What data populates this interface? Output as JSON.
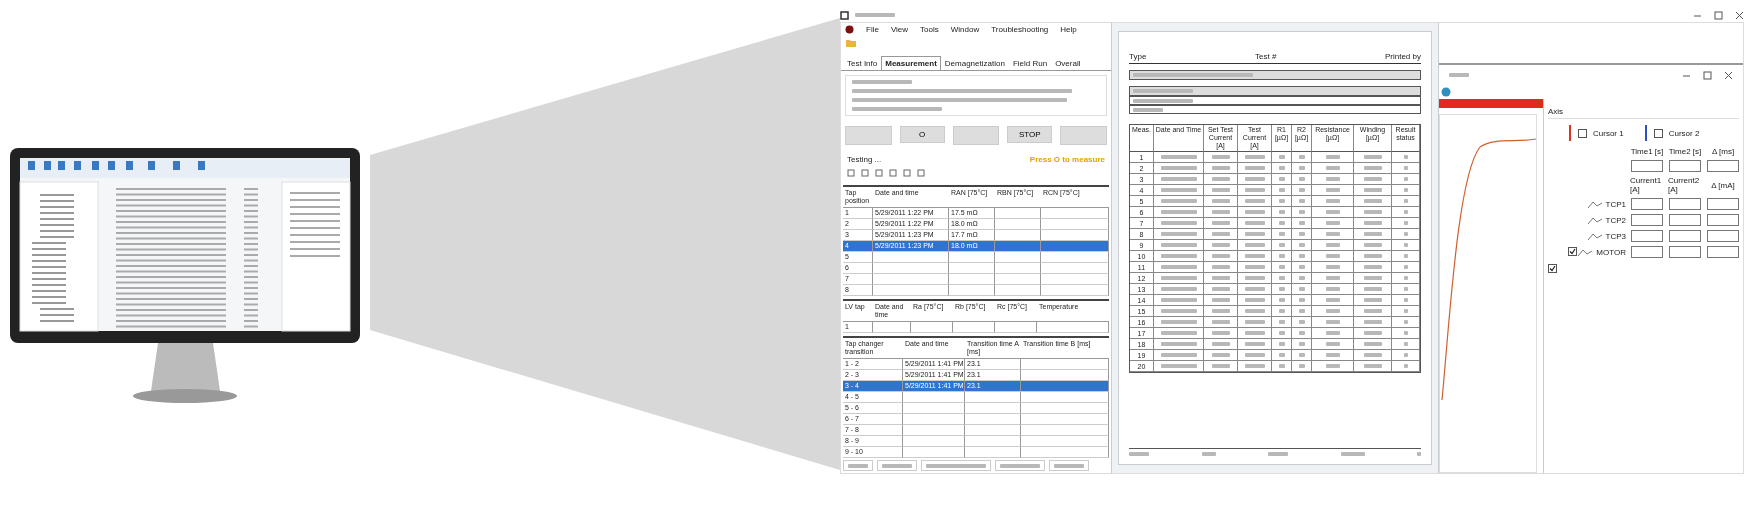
{
  "app_window": {
    "menu": [
      "File",
      "View",
      "Tools",
      "Window",
      "Troubleshooting",
      "Help"
    ],
    "tabs": [
      {
        "label": "Test Info",
        "selected": false
      },
      {
        "label": "Measurement",
        "selected": true
      },
      {
        "label": "Demagnetization",
        "selected": false
      },
      {
        "label": "Field Run",
        "selected": false
      },
      {
        "label": "Overall",
        "selected": false
      }
    ],
    "buttons": [
      "O",
      "STOP"
    ],
    "status": "Testing ...",
    "hint": "Press O to measure",
    "tap_table": {
      "columns": [
        "Tap position",
        "Date and time",
        "RAN [75°C]",
        "RBN [75°C]",
        "RCN [75°C]"
      ],
      "rows": [
        {
          "cells": [
            "1",
            "5/29/2011 1:22 PM",
            "17.5 mΩ",
            "",
            ""
          ],
          "selected": false
        },
        {
          "cells": [
            "2",
            "5/29/2011 1:22 PM",
            "18.0 mΩ",
            "",
            ""
          ],
          "selected": false
        },
        {
          "cells": [
            "3",
            "5/29/2011 1:23 PM",
            "17.7 mΩ",
            "",
            ""
          ],
          "selected": false
        },
        {
          "cells": [
            "4",
            "5/29/2011 1:23 PM",
            "18.0 mΩ",
            "",
            ""
          ],
          "selected": true
        },
        {
          "cells": [
            "5",
            "",
            "",
            "",
            ""
          ],
          "selected": false
        },
        {
          "cells": [
            "6",
            "",
            "",
            "",
            ""
          ],
          "selected": false
        },
        {
          "cells": [
            "7",
            "",
            "",
            "",
            ""
          ],
          "selected": false
        },
        {
          "cells": [
            "8",
            "",
            "",
            "",
            ""
          ],
          "selected": false
        }
      ]
    },
    "lv_table": {
      "columns": [
        "LV tap",
        "Date and time",
        "Ra [75°C]",
        "Rb [75°C]",
        "Rc [75°C]",
        "Temperature"
      ],
      "rows": [
        {
          "cells": [
            "1",
            "",
            "",
            "",
            "",
            ""
          ],
          "selected": false
        }
      ]
    },
    "transition_table": {
      "columns": [
        "Tap changer transition",
        "Date and time",
        "Transition time A [ms]",
        "Transition time B [ms]"
      ],
      "rows": [
        {
          "cells": [
            "1 - 2",
            "5/29/2011 1:41 PM",
            "23.1",
            ""
          ],
          "selected": false
        },
        {
          "cells": [
            "2 - 3",
            "5/29/2011 1:41 PM",
            "23.1",
            ""
          ],
          "selected": false
        },
        {
          "cells": [
            "3 - 4",
            "5/29/2011 1:41 PM",
            "23.1",
            ""
          ],
          "selected": true
        },
        {
          "cells": [
            "4 - 5",
            "",
            "",
            ""
          ],
          "selected": false
        },
        {
          "cells": [
            "5 - 6",
            "",
            "",
            ""
          ],
          "selected": false
        },
        {
          "cells": [
            "6 - 7",
            "",
            "",
            ""
          ],
          "selected": false
        },
        {
          "cells": [
            "7 - 8",
            "",
            "",
            ""
          ],
          "selected": false
        },
        {
          "cells": [
            "8 - 9",
            "",
            "",
            ""
          ],
          "selected": false
        },
        {
          "cells": [
            "9 - 10",
            "",
            "",
            ""
          ],
          "selected": false
        }
      ]
    }
  },
  "report_document": {
    "header": [
      "Type",
      "Test #",
      "Printed by"
    ],
    "columns": [
      "Meas.",
      "Date and Time",
      "Set Test Current [A]",
      "Test Current [A]",
      "R1 [µΩ]",
      "R2 [µΩ]",
      "Resistance [µΩ]",
      "Winding [µΩ]",
      "Result status"
    ],
    "rows": [
      "1",
      "2",
      "3",
      "4",
      "5",
      "6",
      "7",
      "8",
      "9",
      "10",
      "11",
      "12",
      "13",
      "14",
      "15",
      "16",
      "17",
      "18",
      "19",
      "20"
    ]
  },
  "graph_window": {
    "group_title": "Axis",
    "cursors": [
      {
        "label": "Cursor 1",
        "checked": false,
        "color": "#e03020"
      },
      {
        "label": "Cursor 2",
        "checked": false,
        "color": "#3050c0"
      }
    ],
    "time_columns": [
      "Time1 [s]",
      "Time2 [s]",
      "Δ [ms]"
    ],
    "current_columns": [
      "Current1 [A]",
      "Current2 [A]",
      "Δ [mA]"
    ],
    "channels": [
      {
        "label": "TCP1",
        "checked": false
      },
      {
        "label": "TCP2",
        "checked": false
      },
      {
        "label": "TCP3",
        "checked": false
      },
      {
        "label": "MOTOR",
        "checked": true
      }
    ],
    "show_option": {
      "checked": true
    }
  }
}
